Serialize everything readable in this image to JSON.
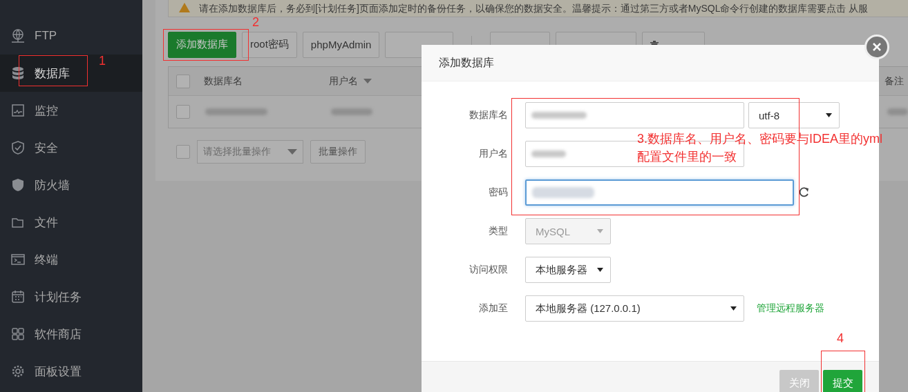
{
  "sidebar": {
    "items": [
      {
        "label": "FTP",
        "selected": false
      },
      {
        "label": "数据库",
        "selected": true
      },
      {
        "label": "监控",
        "selected": false
      },
      {
        "label": "安全",
        "selected": false
      },
      {
        "label": "防火墙",
        "selected": false
      },
      {
        "label": "文件",
        "selected": false
      },
      {
        "label": "终端",
        "selected": false
      },
      {
        "label": "计划任务",
        "selected": false
      },
      {
        "label": "软件商店",
        "selected": false
      },
      {
        "label": "面板设置",
        "selected": false
      }
    ]
  },
  "notice": {
    "text": "请在添加数据库后，务必到[计划任务]页面添加定时的备份任务，以确保您的数据安全。温馨提示：通过第三方或者MySQL命令行创建的数据库需要点击 从服"
  },
  "toolbar": {
    "buttons": [
      {
        "label": "添加数据库",
        "kind": "primary"
      },
      {
        "label": "root密码",
        "kind": "default"
      },
      {
        "label": "phpMyAdmin",
        "kind": "default"
      },
      {
        "kind": "default"
      },
      {
        "kind": "default"
      },
      {
        "kind": "default"
      },
      {
        "kind": "trash"
      }
    ]
  },
  "table": {
    "header_checked": false,
    "columns": [
      "数据库名",
      "用户名",
      "备注"
    ],
    "rows": [
      {
        "checked": false
      }
    ]
  },
  "batch": {
    "checked": false,
    "placeholder": "请选择批量操作",
    "button": "批量操作"
  },
  "dialog": {
    "title": "添加数据库",
    "fields": [
      {
        "label": "数据库名",
        "kind": "text",
        "focused": false,
        "addon": "utf-8"
      },
      {
        "label": "用户名",
        "kind": "text",
        "focused": false
      },
      {
        "label": "密码",
        "kind": "text",
        "focused": true,
        "refresh": true
      },
      {
        "label": "类型",
        "kind": "select",
        "value": "MySQL",
        "disabled": true
      },
      {
        "label": "访问权限",
        "kind": "select",
        "value": "本地服务器",
        "disabled": false
      },
      {
        "label": "添加至",
        "kind": "combo",
        "value": "本地服务器 (127.0.0.1)",
        "link": "管理远程服务器"
      }
    ],
    "buttons": [
      {
        "label": "关闭",
        "kind": "cancel"
      },
      {
        "label": "提交",
        "kind": "primary"
      }
    ]
  },
  "annotations": [
    {
      "label": "1"
    },
    {
      "label": "2"
    },
    {
      "label": "3.数据库名、用户名、密码要与IDEA里的yml配置文件里的一致"
    },
    {
      "label": "4"
    }
  ]
}
